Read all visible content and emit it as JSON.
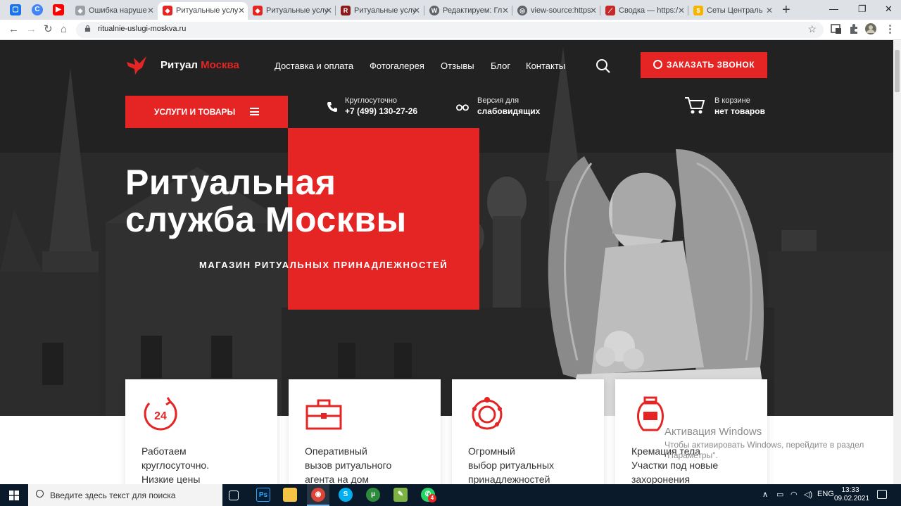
{
  "browser": {
    "tabs": [
      {
        "title": "Ошибка наруше",
        "active": false
      },
      {
        "title": "Ритуальные услу",
        "active": true
      },
      {
        "title": "Ритуальные услу",
        "active": false
      },
      {
        "title": "Ритуальные услу",
        "active": false
      },
      {
        "title": "Редактируем: Гл",
        "active": false
      },
      {
        "title": "view-source:https",
        "active": false
      },
      {
        "title": "Сводка — https:/",
        "active": false
      },
      {
        "title": "Сеты Централь",
        "active": false
      }
    ],
    "url": "ritualnie-uslugi-moskva.ru"
  },
  "site": {
    "logo_main": "Ритуал",
    "logo_accent": "Москва",
    "nav": [
      "Доставка и оплата",
      "Фотогалерея",
      "Отзывы",
      "Блог",
      "Контакты"
    ],
    "call_button": "ЗАКАЗАТЬ ЗВОНОК",
    "services_button": "УСЛУГИ И ТОВАРЫ",
    "phone_label": "Круглосуточно",
    "phone": "+7 (499) 130-27-26",
    "accessibility_label": "Версия для",
    "accessibility_value": "слабовидящих",
    "cart_label": "В корзине",
    "cart_value": "нет товаров",
    "hero_title_1": "Ритуальная",
    "hero_title_2": "служба Москвы",
    "hero_subtitle": "МАГАЗИН РИТУАЛЬНЫХ ПРИНАДЛЕЖНОСТЕЙ",
    "accent_color": "#e52424",
    "cards": [
      {
        "lines": [
          "Работаем",
          "круглосуточно.",
          "Низкие цены"
        ],
        "icon": "clock-24-icon"
      },
      {
        "lines": [
          "Оперативный",
          "вызов ритуального",
          "агента на дом"
        ],
        "icon": "briefcase-icon"
      },
      {
        "lines": [
          "Огромный",
          "выбор ритуальных",
          "принадлежностей"
        ],
        "icon": "wreath-icon"
      },
      {
        "lines": [
          "Кремация тела",
          "Участки под новые",
          "захоронения"
        ],
        "icon": "urn-icon"
      }
    ]
  },
  "windows_activation": {
    "title": "Активация Windows",
    "text": "Чтобы активировать Windows, перейдите в раздел \"Параметры\"."
  },
  "taskbar": {
    "search_placeholder": "Введите здесь текст для поиска",
    "language": "ENG",
    "time": "13:33",
    "date": "09.02.2021",
    "whatsapp_badge": "4"
  }
}
